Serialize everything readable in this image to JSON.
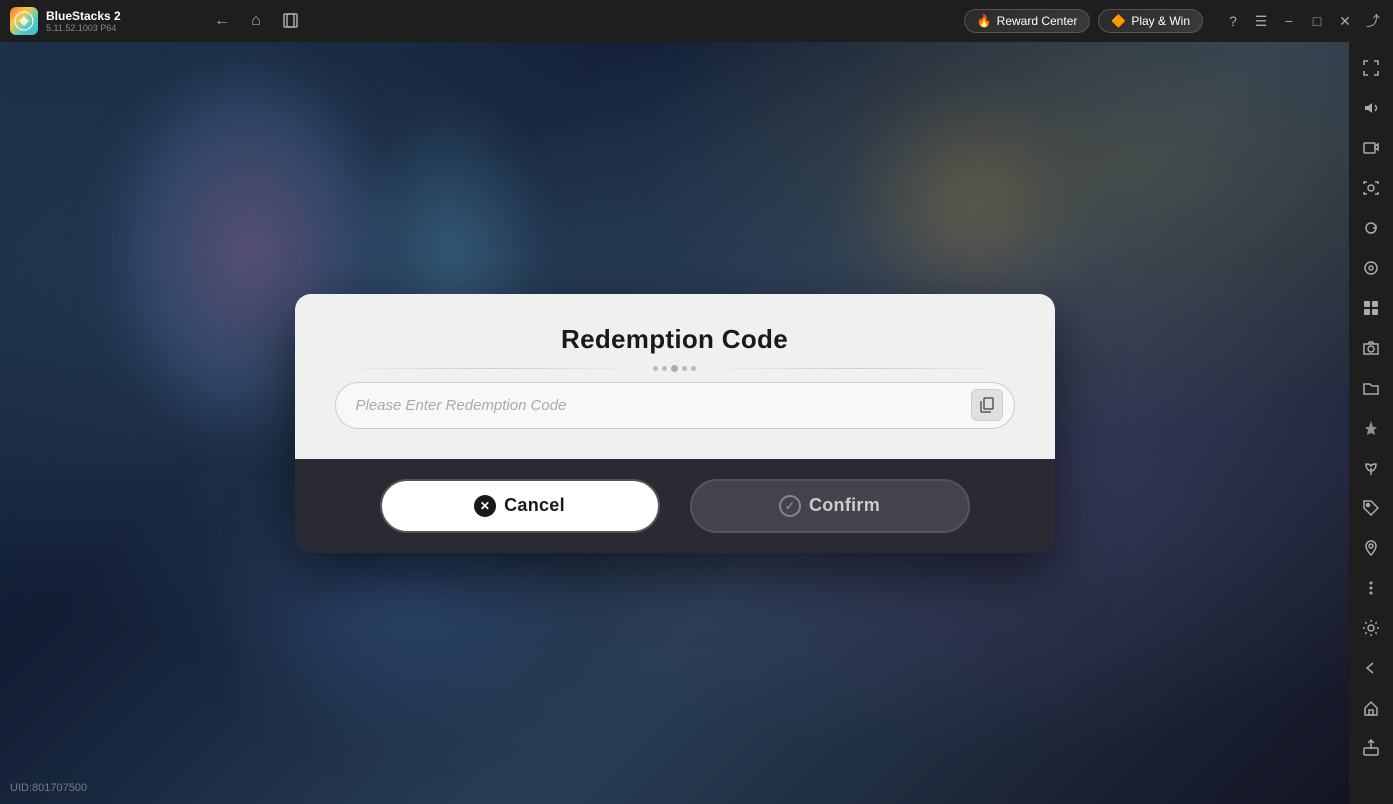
{
  "app": {
    "name": "BlueStacks 2",
    "version": "5.11.52.1003  P64"
  },
  "topbar": {
    "back_label": "←",
    "home_label": "⌂",
    "bookmark_label": "❐",
    "reward_center_label": "Reward Center",
    "play_win_label": "Play & Win",
    "help_label": "?",
    "menu_label": "☰",
    "minimize_label": "−",
    "maximize_label": "□",
    "close_label": "✕",
    "expand_label": "⤢"
  },
  "sidebar": {
    "icons": [
      {
        "name": "fullscreen-icon",
        "symbol": "⤢"
      },
      {
        "name": "volume-icon",
        "symbol": "🔊"
      },
      {
        "name": "video-icon",
        "symbol": "▶"
      },
      {
        "name": "camera-icon",
        "symbol": "📷"
      },
      {
        "name": "rotate-icon",
        "symbol": "↺"
      },
      {
        "name": "fps-icon",
        "symbol": "⊙"
      },
      {
        "name": "apps-icon",
        "symbol": "⊞"
      },
      {
        "name": "screenshot-icon",
        "symbol": "📸"
      },
      {
        "name": "folder-icon",
        "symbol": "📁"
      },
      {
        "name": "flight-icon",
        "symbol": "✈"
      },
      {
        "name": "eco-icon",
        "symbol": "🌿"
      },
      {
        "name": "tag-icon",
        "symbol": "🏷"
      },
      {
        "name": "location-icon",
        "symbol": "📍"
      },
      {
        "name": "more-icon",
        "symbol": "•••"
      },
      {
        "name": "settings-icon",
        "symbol": "⚙"
      },
      {
        "name": "back-nav-icon",
        "symbol": "←"
      },
      {
        "name": "home-nav-icon",
        "symbol": "⌂"
      },
      {
        "name": "share-icon",
        "symbol": "⬆"
      }
    ]
  },
  "dialog": {
    "title": "Redemption Code",
    "input_placeholder": "Please Enter Redemption Code",
    "cancel_label": "Cancel",
    "confirm_label": "Confirm"
  },
  "uid": {
    "label": "UID:801707500"
  }
}
